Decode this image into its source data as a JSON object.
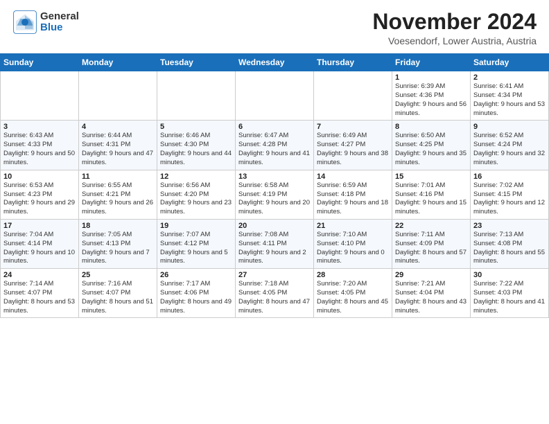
{
  "header": {
    "logo_general": "General",
    "logo_blue": "Blue",
    "month_title": "November 2024",
    "subtitle": "Voesendorf, Lower Austria, Austria"
  },
  "weekdays": [
    "Sunday",
    "Monday",
    "Tuesday",
    "Wednesday",
    "Thursday",
    "Friday",
    "Saturday"
  ],
  "weeks": [
    [
      {
        "day": "",
        "info": ""
      },
      {
        "day": "",
        "info": ""
      },
      {
        "day": "",
        "info": ""
      },
      {
        "day": "",
        "info": ""
      },
      {
        "day": "",
        "info": ""
      },
      {
        "day": "1",
        "info": "Sunrise: 6:39 AM\nSunset: 4:36 PM\nDaylight: 9 hours\nand 56 minutes."
      },
      {
        "day": "2",
        "info": "Sunrise: 6:41 AM\nSunset: 4:34 PM\nDaylight: 9 hours\nand 53 minutes."
      }
    ],
    [
      {
        "day": "3",
        "info": "Sunrise: 6:43 AM\nSunset: 4:33 PM\nDaylight: 9 hours\nand 50 minutes."
      },
      {
        "day": "4",
        "info": "Sunrise: 6:44 AM\nSunset: 4:31 PM\nDaylight: 9 hours\nand 47 minutes."
      },
      {
        "day": "5",
        "info": "Sunrise: 6:46 AM\nSunset: 4:30 PM\nDaylight: 9 hours\nand 44 minutes."
      },
      {
        "day": "6",
        "info": "Sunrise: 6:47 AM\nSunset: 4:28 PM\nDaylight: 9 hours\nand 41 minutes."
      },
      {
        "day": "7",
        "info": "Sunrise: 6:49 AM\nSunset: 4:27 PM\nDaylight: 9 hours\nand 38 minutes."
      },
      {
        "day": "8",
        "info": "Sunrise: 6:50 AM\nSunset: 4:25 PM\nDaylight: 9 hours\nand 35 minutes."
      },
      {
        "day": "9",
        "info": "Sunrise: 6:52 AM\nSunset: 4:24 PM\nDaylight: 9 hours\nand 32 minutes."
      }
    ],
    [
      {
        "day": "10",
        "info": "Sunrise: 6:53 AM\nSunset: 4:23 PM\nDaylight: 9 hours\nand 29 minutes."
      },
      {
        "day": "11",
        "info": "Sunrise: 6:55 AM\nSunset: 4:21 PM\nDaylight: 9 hours\nand 26 minutes."
      },
      {
        "day": "12",
        "info": "Sunrise: 6:56 AM\nSunset: 4:20 PM\nDaylight: 9 hours\nand 23 minutes."
      },
      {
        "day": "13",
        "info": "Sunrise: 6:58 AM\nSunset: 4:19 PM\nDaylight: 9 hours\nand 20 minutes."
      },
      {
        "day": "14",
        "info": "Sunrise: 6:59 AM\nSunset: 4:18 PM\nDaylight: 9 hours\nand 18 minutes."
      },
      {
        "day": "15",
        "info": "Sunrise: 7:01 AM\nSunset: 4:16 PM\nDaylight: 9 hours\nand 15 minutes."
      },
      {
        "day": "16",
        "info": "Sunrise: 7:02 AM\nSunset: 4:15 PM\nDaylight: 9 hours\nand 12 minutes."
      }
    ],
    [
      {
        "day": "17",
        "info": "Sunrise: 7:04 AM\nSunset: 4:14 PM\nDaylight: 9 hours\nand 10 minutes."
      },
      {
        "day": "18",
        "info": "Sunrise: 7:05 AM\nSunset: 4:13 PM\nDaylight: 9 hours\nand 7 minutes."
      },
      {
        "day": "19",
        "info": "Sunrise: 7:07 AM\nSunset: 4:12 PM\nDaylight: 9 hours\nand 5 minutes."
      },
      {
        "day": "20",
        "info": "Sunrise: 7:08 AM\nSunset: 4:11 PM\nDaylight: 9 hours\nand 2 minutes."
      },
      {
        "day": "21",
        "info": "Sunrise: 7:10 AM\nSunset: 4:10 PM\nDaylight: 9 hours\nand 0 minutes."
      },
      {
        "day": "22",
        "info": "Sunrise: 7:11 AM\nSunset: 4:09 PM\nDaylight: 8 hours\nand 57 minutes."
      },
      {
        "day": "23",
        "info": "Sunrise: 7:13 AM\nSunset: 4:08 PM\nDaylight: 8 hours\nand 55 minutes."
      }
    ],
    [
      {
        "day": "24",
        "info": "Sunrise: 7:14 AM\nSunset: 4:07 PM\nDaylight: 8 hours\nand 53 minutes."
      },
      {
        "day": "25",
        "info": "Sunrise: 7:16 AM\nSunset: 4:07 PM\nDaylight: 8 hours\nand 51 minutes."
      },
      {
        "day": "26",
        "info": "Sunrise: 7:17 AM\nSunset: 4:06 PM\nDaylight: 8 hours\nand 49 minutes."
      },
      {
        "day": "27",
        "info": "Sunrise: 7:18 AM\nSunset: 4:05 PM\nDaylight: 8 hours\nand 47 minutes."
      },
      {
        "day": "28",
        "info": "Sunrise: 7:20 AM\nSunset: 4:05 PM\nDaylight: 8 hours\nand 45 minutes."
      },
      {
        "day": "29",
        "info": "Sunrise: 7:21 AM\nSunset: 4:04 PM\nDaylight: 8 hours\nand 43 minutes."
      },
      {
        "day": "30",
        "info": "Sunrise: 7:22 AM\nSunset: 4:03 PM\nDaylight: 8 hours\nand 41 minutes."
      }
    ]
  ]
}
